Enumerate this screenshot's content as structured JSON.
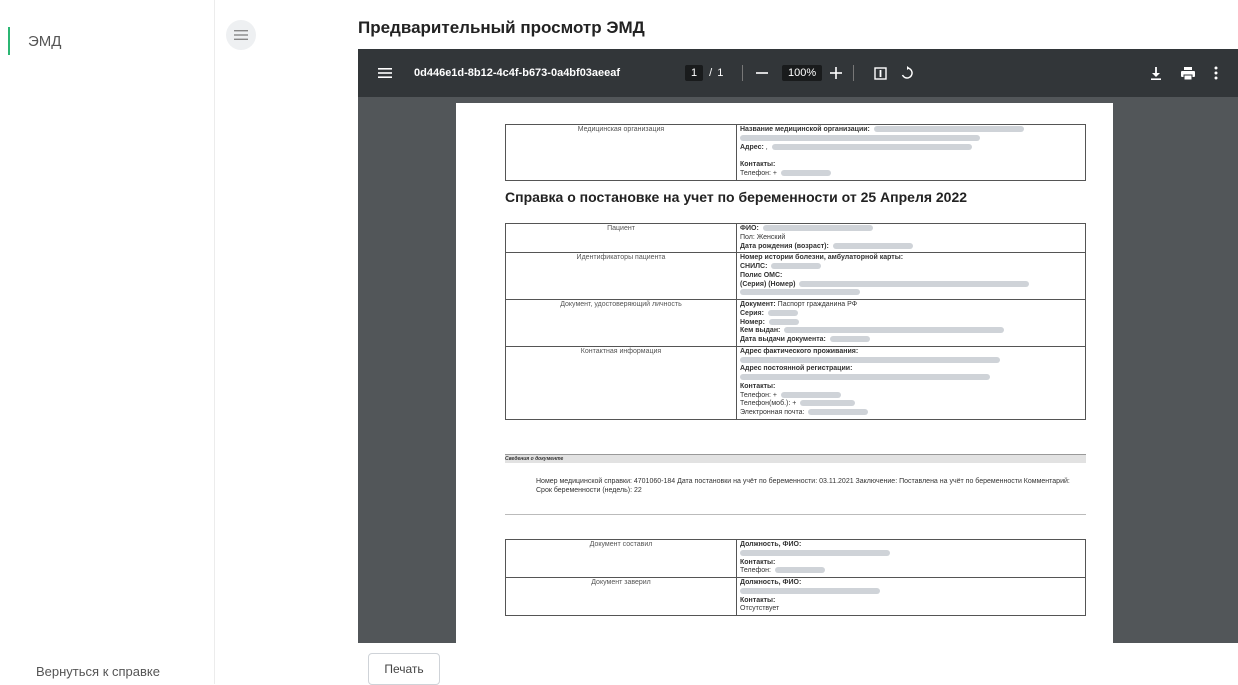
{
  "sidebar": {
    "active_item": "ЭМД",
    "back_link": "Вернуться к справке"
  },
  "header": {
    "title": "Предварительный просмотр ЭМД"
  },
  "viewer": {
    "file_name": "0d446e1d-8b12-4c4f-b673-0a4bf03aeeaf",
    "page_current": "1",
    "page_sep": "/",
    "page_total": "1",
    "zoom": "100%"
  },
  "document": {
    "org": {
      "label": "Медицинская организация",
      "name_label": "Название медицинской организации:",
      "address_label": "Адрес:",
      "address_value": ",",
      "contacts_label": "Контакты:",
      "phone_label": "Телефон: +"
    },
    "title": "Справка о постановке на учет по беременности от 25 Апреля 2022",
    "patient": {
      "label": "Пациент",
      "fio_label": "ФИО:",
      "sex_label": "Пол:",
      "sex_value": "Женский",
      "dob_label": "Дата рождения (возраст):"
    },
    "ids": {
      "label": "Идентификаторы пациента",
      "history_label": "Номер истории болезни, амбулаторной карты:",
      "snils_label": "СНИЛС:",
      "oms_label": "Полис ОМС:",
      "series_label": "(Серия) (Номер)"
    },
    "identity": {
      "label": "Документ, удостоверяющий личность",
      "doc_label": "Документ:",
      "doc_value": "Паспорт гражданина РФ",
      "series_label": "Серия:",
      "number_label": "Номер:",
      "issued_label": "Кем выдан:",
      "date_label": "Дата выдачи документа:"
    },
    "contact": {
      "label": "Контактная информация",
      "actual_addr_label": "Адрес фактического проживания:",
      "reg_addr_label": "Адрес постоянной регистрации:",
      "contacts_label": "Контакты:",
      "phone_label": "Телефон: +",
      "mobile_label": "Телефон(моб.): +",
      "email_label": "Электронная почта:"
    },
    "info": {
      "heading": "Сведения о документе",
      "text": "Номер медицинской справки: 4701060-184 Дата постановки на учёт по беременности: 03.11.2021 Заключение: Поставлена на учёт по беременности Комментарий: Срок беременности (недель): 22"
    },
    "author": {
      "label": "Документ составил",
      "position_label": "Должность, ФИО:",
      "contacts_label": "Контакты:",
      "phone_label": "Телефон:"
    },
    "verifier": {
      "label": "Документ заверил",
      "position_label": "Должность, ФИО:",
      "contacts_label": "Контакты:",
      "contacts_value": "Отсутствует"
    }
  },
  "actions": {
    "print_label": "Печать"
  },
  "colors": {
    "accent": "#2bb673",
    "toolbar_bg": "#323639",
    "viewer_bg": "#525659"
  },
  "icons": [
    "menu-icon",
    "zoom-out-icon",
    "zoom-in-icon",
    "fit-page-icon",
    "rotate-icon",
    "download-icon",
    "print-icon",
    "more-vert-icon"
  ]
}
